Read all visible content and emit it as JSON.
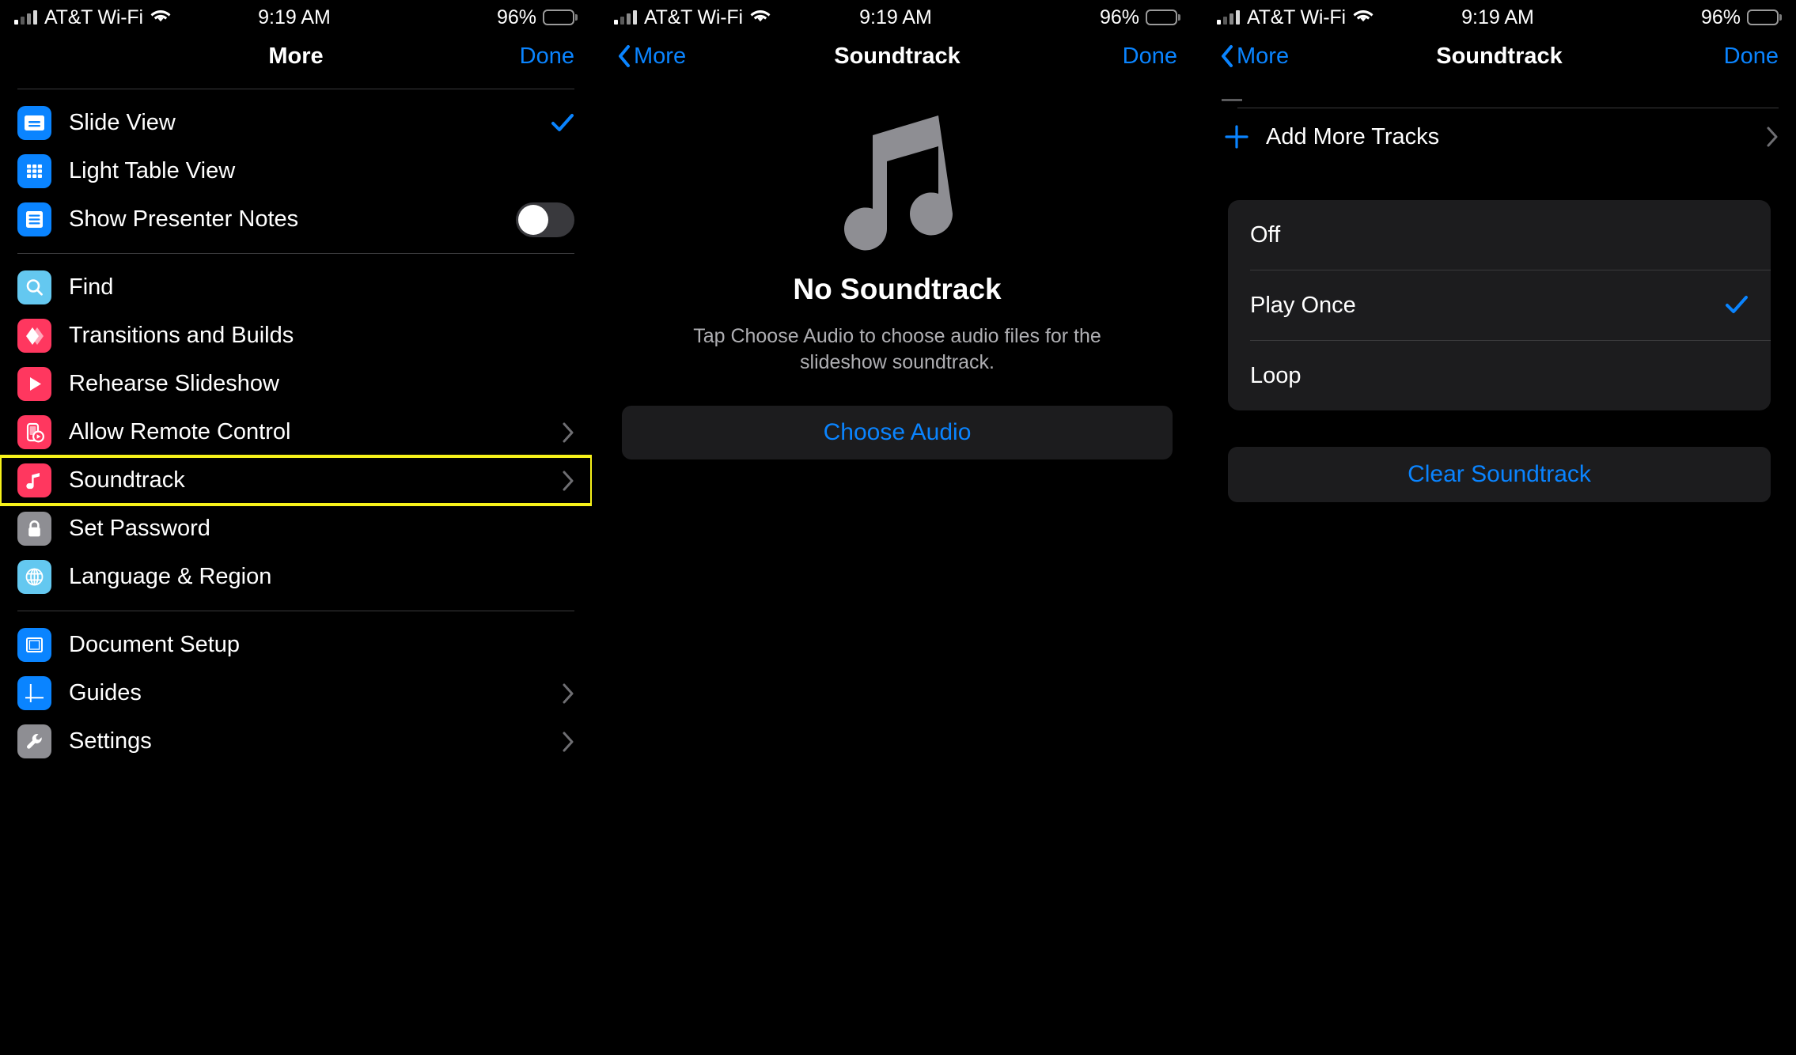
{
  "status_bar": {
    "carrier": "AT&T Wi-Fi",
    "time": "9:19 AM",
    "battery_percent": "96%",
    "wifi_icon": "wifi-icon",
    "signal_icon": "cellular-signal-icon",
    "battery_icon": "battery-icon"
  },
  "panel1": {
    "nav": {
      "title": "More",
      "done_label": "Done"
    },
    "sections": [
      {
        "items": [
          {
            "label": "Slide View",
            "icon": "slide-view-icon",
            "accessory": "check"
          },
          {
            "label": "Light Table View",
            "icon": "light-table-view-icon",
            "accessory": "none"
          },
          {
            "label": "Show Presenter Notes",
            "icon": "presenter-notes-icon",
            "accessory": "toggle",
            "toggle_on": false
          }
        ]
      },
      {
        "items": [
          {
            "label": "Find",
            "icon": "search-icon",
            "accessory": "none"
          },
          {
            "label": "Transitions and Builds",
            "icon": "transitions-icon",
            "accessory": "none"
          },
          {
            "label": "Rehearse Slideshow",
            "icon": "play-icon",
            "accessory": "none"
          },
          {
            "label": "Allow Remote Control",
            "icon": "remote-control-icon",
            "accessory": "chevron"
          },
          {
            "label": "Soundtrack",
            "icon": "music-note-icon",
            "accessory": "chevron",
            "highlighted": true
          },
          {
            "label": "Set Password",
            "icon": "lock-icon",
            "accessory": "none"
          },
          {
            "label": "Language & Region",
            "icon": "globe-icon",
            "accessory": "none"
          }
        ]
      },
      {
        "items": [
          {
            "label": "Document Setup",
            "icon": "document-setup-icon",
            "accessory": "none"
          },
          {
            "label": "Guides",
            "icon": "guides-icon",
            "accessory": "chevron"
          },
          {
            "label": "Settings",
            "icon": "wrench-icon",
            "accessory": "chevron"
          }
        ]
      }
    ]
  },
  "panel2": {
    "nav": {
      "back_label": "More",
      "title": "Soundtrack",
      "done_label": "Done"
    },
    "empty_state": {
      "icon": "music-note-large-icon",
      "title": "No Soundtrack",
      "subtitle": "Tap Choose Audio to choose audio files for the slideshow soundtrack."
    },
    "choose_audio_label": "Choose Audio"
  },
  "panel3": {
    "nav": {
      "back_label": "More",
      "title": "Soundtrack",
      "done_label": "Done"
    },
    "add_more_tracks": {
      "label": "Add More Tracks",
      "icon": "plus-icon",
      "accessory": "chevron"
    },
    "playback_options": [
      {
        "label": "Off",
        "selected": false
      },
      {
        "label": "Play Once",
        "selected": true
      },
      {
        "label": "Loop",
        "selected": false
      }
    ],
    "clear_label": "Clear Soundtrack"
  },
  "colors": {
    "accent_blue": "#0a84ff",
    "highlight_yellow": "#f7f21a",
    "icon_red": "#ff375f",
    "icon_blue": "#0a84ff",
    "icon_lightblue": "#64c8f0",
    "icon_gray": "#8e8e93",
    "group_bg": "#1c1c1e"
  }
}
